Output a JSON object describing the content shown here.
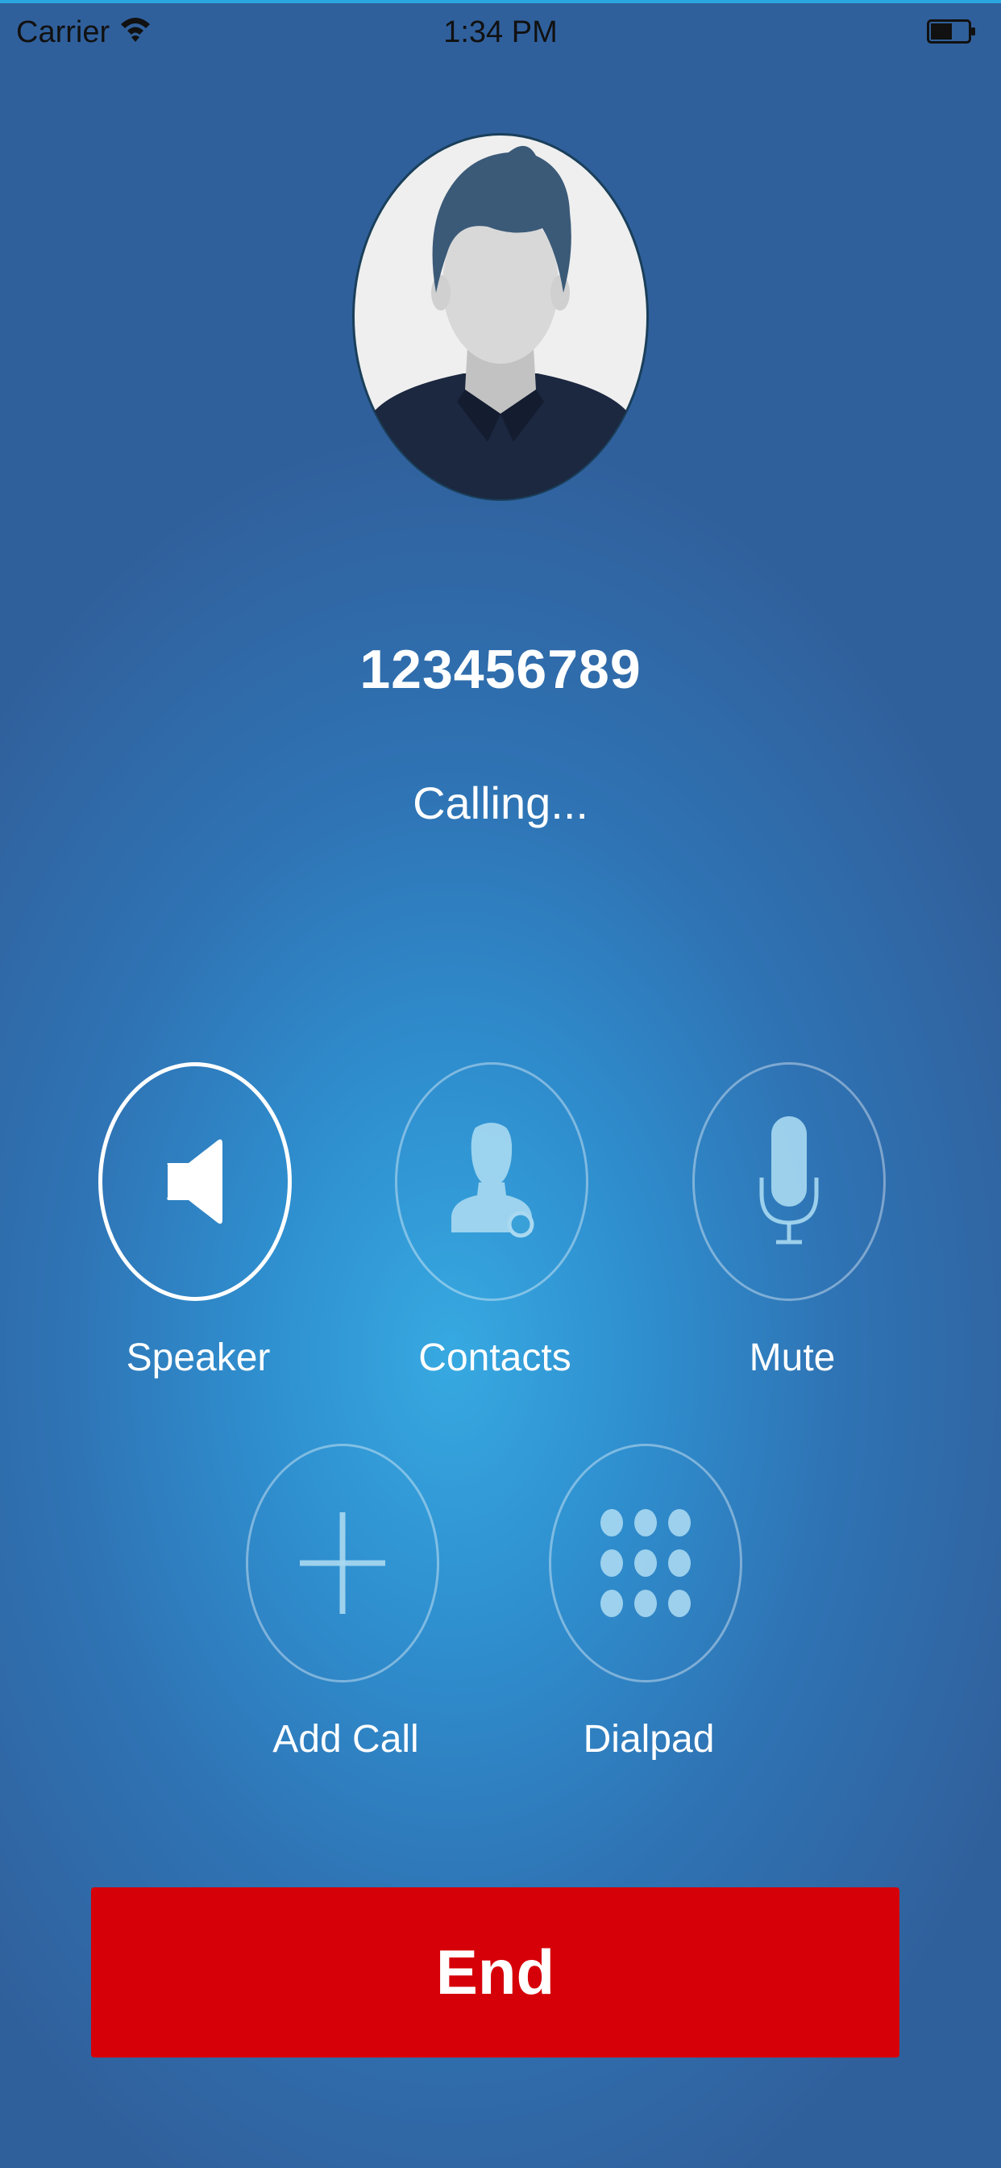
{
  "status_bar": {
    "carrier": "Carrier",
    "time": "1:34 PM",
    "wifi_icon": "wifi-icon",
    "battery_icon": "battery-icon"
  },
  "call": {
    "number": "123456789",
    "status": "Calling..."
  },
  "controls": {
    "speaker": {
      "label": "Speaker",
      "icon": "speaker-icon",
      "active": true
    },
    "contacts": {
      "label": "Contacts",
      "icon": "contacts-icon",
      "active": false
    },
    "mute": {
      "label": "Mute",
      "icon": "microphone-icon",
      "active": false
    },
    "add_call": {
      "label": "Add Call",
      "icon": "plus-icon",
      "active": false
    },
    "dialpad": {
      "label": "Dialpad",
      "icon": "dialpad-icon",
      "active": false
    }
  },
  "end_button": {
    "label": "End"
  },
  "colors": {
    "end_red": "#d60009",
    "background_light": "#37a9e1",
    "background_dark": "#30609c"
  }
}
